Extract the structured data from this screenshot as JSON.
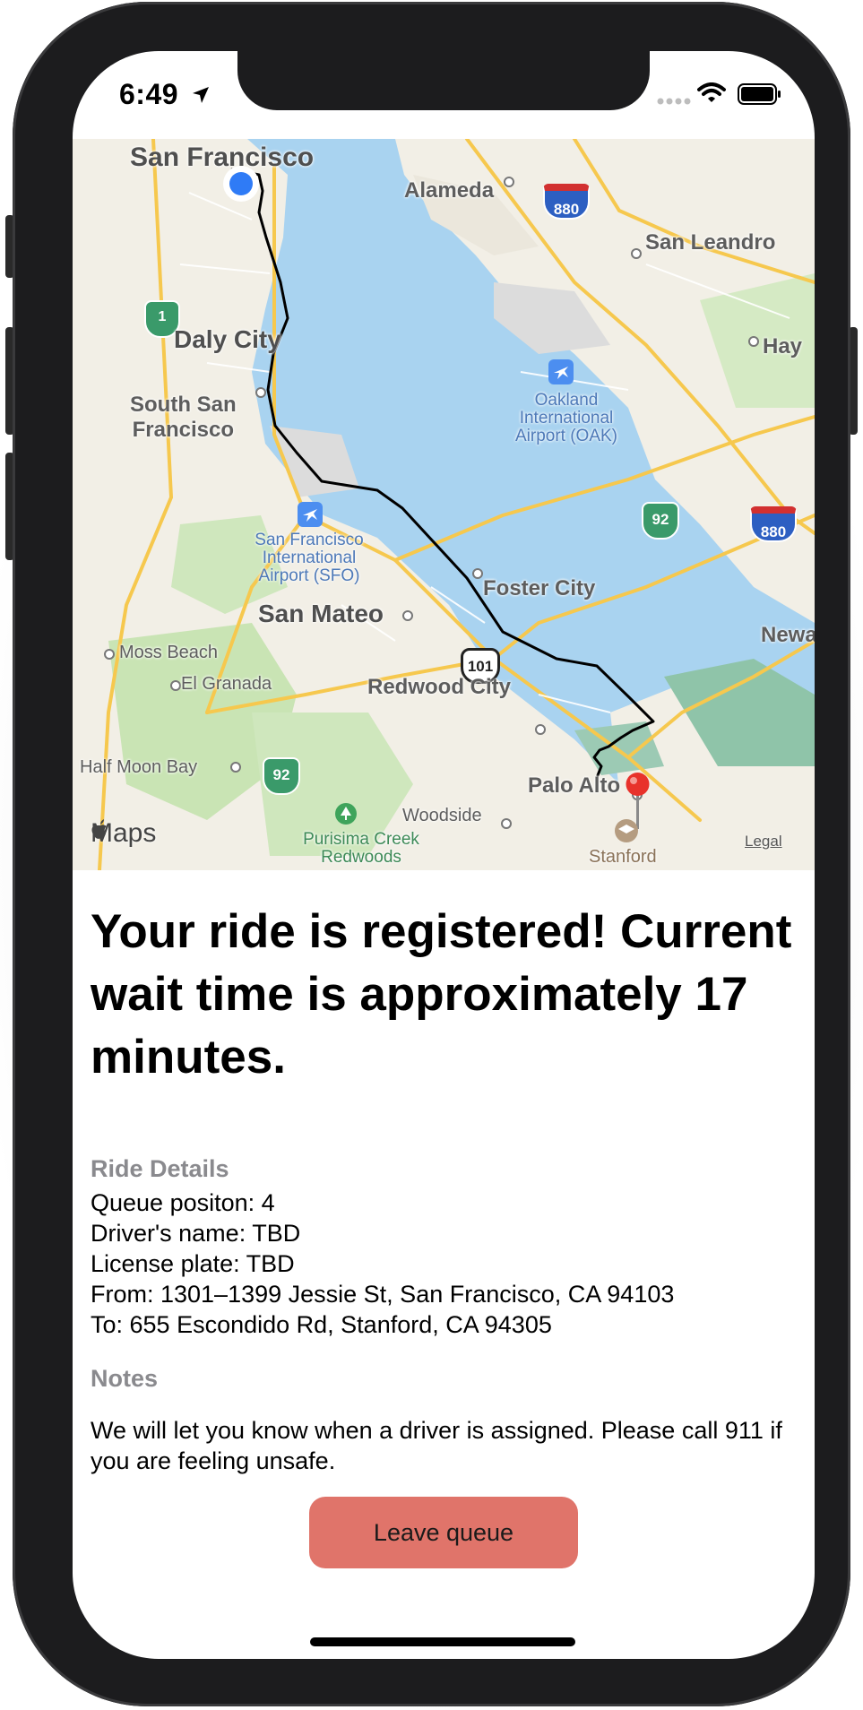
{
  "status_bar": {
    "time": "6:49",
    "icons": [
      "location-arrow-icon",
      "signal-icon",
      "wifi-icon",
      "battery-icon"
    ]
  },
  "map": {
    "labels": {
      "san_francisco": "San Francisco",
      "alameda": "Alameda",
      "san_leandro": "San Leandro",
      "oakland_airport_1": "Oakland",
      "oakland_airport_2": "International",
      "oakland_airport_3": "Airport (OAK)",
      "hayward": "Hay",
      "daly_city": "Daly City",
      "south_sf_1": "South San",
      "south_sf_2": "Francisco",
      "sfo_1": "San Francisco",
      "sfo_2": "International",
      "sfo_3": "Airport (SFO)",
      "foster_city": "Foster City",
      "san_mateo": "San Mateo",
      "moss_beach": "Moss Beach",
      "el_granada": "El Granada",
      "redwood_city": "Redwood City",
      "newark": "Newa",
      "half_moon_bay": "Half Moon Bay",
      "palo_alto": "Palo Alto",
      "woodside": "Woodside",
      "purisima_1": "Purisima Creek",
      "purisima_2": "Redwoods",
      "stanford": "Stanford"
    },
    "shields": {
      "hwy1": "1",
      "i880_a": "880",
      "i880_b": "880",
      "hwy92_a": "92",
      "hwy92_b": "92",
      "us101": "101"
    },
    "maps_brand": "Maps",
    "legal": "Legal"
  },
  "headline": "Your ride is registered! Current wait time is approximately 17 minutes.",
  "ride_details": {
    "title": "Ride Details",
    "queue_position": "Queue positon: 4",
    "driver_name": "Driver's name: TBD",
    "license_plate": "License plate: TBD",
    "from": "From: 1301–1399 Jessie St, San Francisco, CA 94103",
    "to": "To: 655 Escondido Rd, Stanford, CA 94305"
  },
  "notes": {
    "title": "Notes",
    "text": "We will let you know when a driver is assigned. Please call 911 if you are feeling unsafe."
  },
  "leave_button": "Leave queue",
  "colors": {
    "button": "#e0746a",
    "water": "#a9d3f0",
    "land": "#f2efe6",
    "park": "#c9e4b4",
    "route": "#000000",
    "user_dot": "#2f7bf6",
    "pin": "#e8322b"
  }
}
